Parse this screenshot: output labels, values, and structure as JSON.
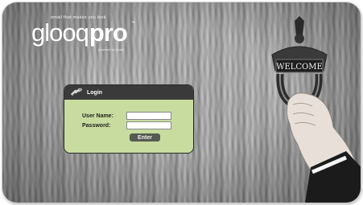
{
  "brand": {
    "tagline": "email that makes you look",
    "logo_main": "glooq",
    "logo_pro": "pro",
    "trademark": "™",
    "powered_by": "powered by (mail)"
  },
  "login": {
    "title": "Login",
    "username_label": "User Name:",
    "username_value": "",
    "password_label": "Password:",
    "password_value": "",
    "enter_label": "Enter"
  },
  "door_plate": {
    "text": "WELCOME"
  },
  "colors": {
    "login_panel": "#c8dc9f",
    "login_header": "#3a3a3a",
    "enter_button": "#555a52"
  },
  "icons": {
    "login": "key-hand-icon"
  }
}
